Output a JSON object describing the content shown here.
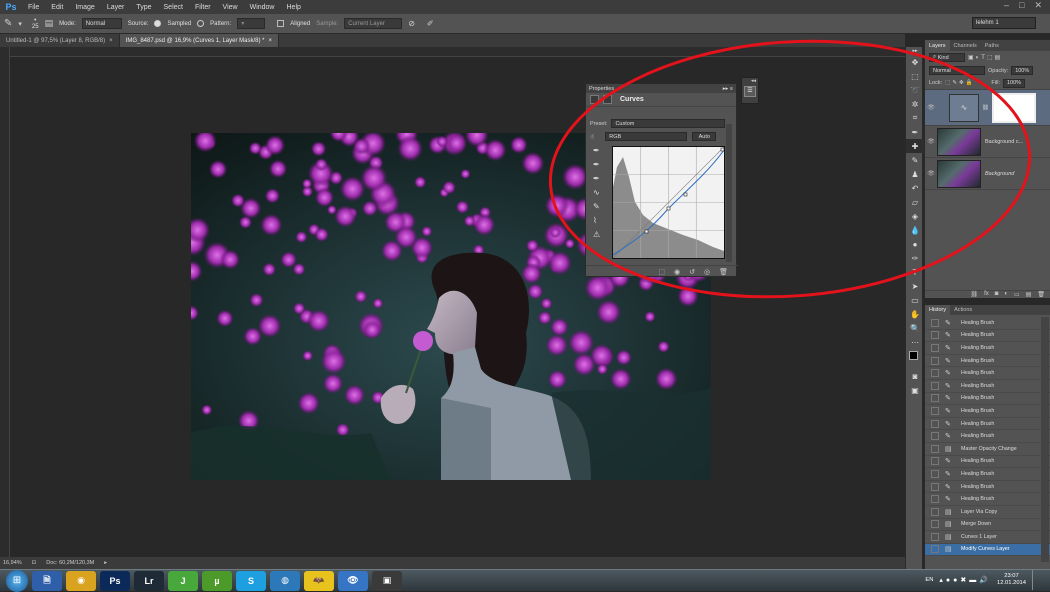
{
  "app": {
    "logo": "Ps",
    "window_controls": [
      "–",
      "□",
      "✕"
    ]
  },
  "menu": [
    "File",
    "Edit",
    "Image",
    "Layer",
    "Type",
    "Select",
    "Filter",
    "View",
    "Window",
    "Help"
  ],
  "options_bar": {
    "brush_size": "25",
    "mode_label": "Mode:",
    "mode_value": "Normal",
    "source_label": "Source:",
    "sampled_label": "Sampled",
    "pattern_label": "Pattern:",
    "aligned_label": "Aligned",
    "sample_label": "Sample:",
    "sample_value": "Current Layer",
    "workspace": "lelehm 1"
  },
  "doc_tabs": [
    {
      "label": "Untitled-1 @ 97,5% (Layer 8, RGB/8)",
      "active": false
    },
    {
      "label": "IMG_8487.psd @ 16,9% (Curves 1, Layer Mask/8) *",
      "active": true
    }
  ],
  "status": {
    "zoom": "16,94%",
    "doc": "Doc: 60,2M/120,3M"
  },
  "properties": {
    "title": "Properties",
    "panel_name": "Curves",
    "preset_label": "Preset:",
    "preset_value": "Custom",
    "channel_value": "RGB",
    "auto_label": "Auto"
  },
  "layers_panel": {
    "tabs": [
      "Layers",
      "Channels",
      "Paths"
    ],
    "filter_kind": "Kind",
    "blend_mode": "Normal",
    "opacity_label": "Opacity:",
    "opacity_value": "100%",
    "lock_label": "Lock:",
    "fill_label": "Fill:",
    "fill_value": "100%",
    "layers": [
      {
        "name": "",
        "type": "curves"
      },
      {
        "name": "Background c...",
        "type": "image"
      },
      {
        "name": "Background",
        "type": "image"
      }
    ]
  },
  "history_panel": {
    "tabs": [
      "History",
      "Actions"
    ],
    "items": [
      "Healing Brush",
      "Healing Brush",
      "Healing Brush",
      "Healing Brush",
      "Healing Brush",
      "Healing Brush",
      "Healing Brush",
      "Healing Brush",
      "Healing Brush",
      "Healing Brush",
      "Master Opacity Change",
      "Healing Brush",
      "Healing Brush",
      "Healing Brush",
      "Healing Brush",
      "Layer Via Copy",
      "Merge Down",
      "Curves 1 Layer",
      "Modify Curves Layer"
    ],
    "selected_index": 18
  },
  "taskbar": {
    "apps": [
      "🗎",
      "◉",
      "Ps",
      "Lr",
      "J",
      "µ",
      "S",
      "◍",
      "🦇",
      "👁",
      "▣"
    ],
    "lang": "EN",
    "time": "23:07",
    "date": "12.01.2014"
  }
}
